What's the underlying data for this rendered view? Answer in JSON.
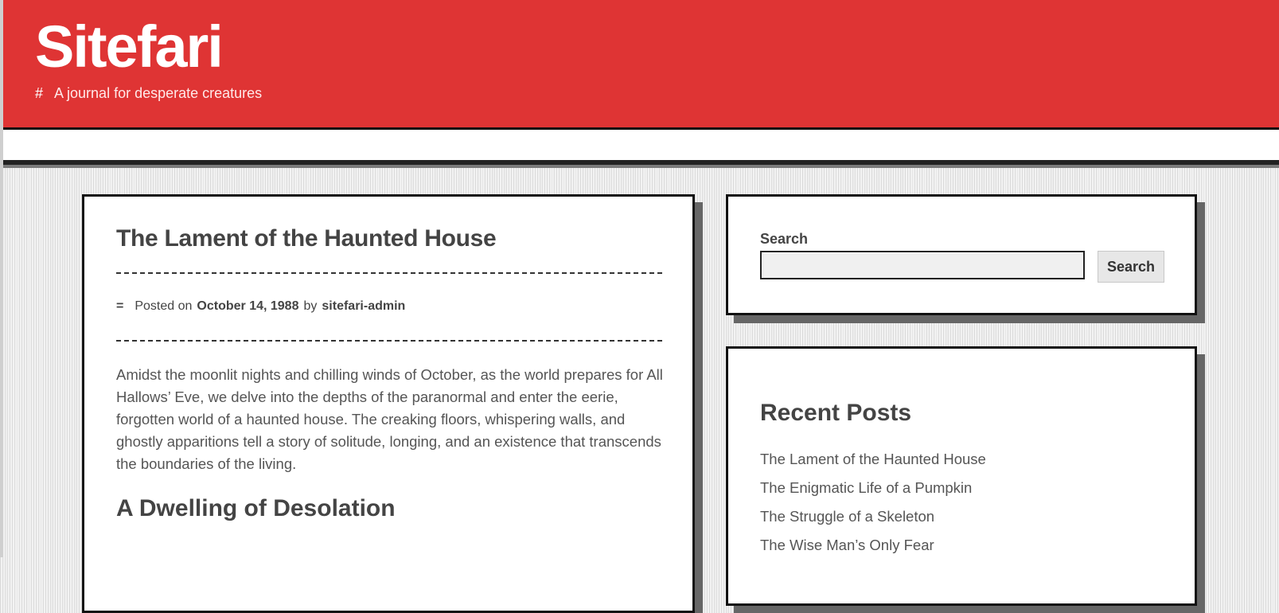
{
  "site": {
    "title": "Sitefari",
    "tagline_icon": "#",
    "tagline": "A journal for desperate creatures"
  },
  "post": {
    "title": "The Lament of the Haunted House",
    "meta_icon": "=",
    "posted_on_label": "Posted on",
    "date": "October 14, 1988",
    "by_label": "by",
    "author": "sitefari-admin",
    "body": "Amidst the moonlit nights and chilling winds of October, as the world prepares for All Hallows’ Eve, we delve into the depths of the paranormal and enter the eerie, forgotten world of a haunted house. The creaking floors, whispering walls, and ghostly apparitions tell a story of solitude, longing, and an existence that transcends the boundaries of the living.",
    "section_heading": "A Dwelling of Desolation"
  },
  "sidebar": {
    "search": {
      "label": "Search",
      "value": "",
      "button_label": "Search"
    },
    "recent_posts": {
      "title": "Recent Posts",
      "items": [
        "The Lament of the Haunted House",
        "The Enigmatic Life of a Pumpkin",
        "The Struggle of a Skeleton",
        "The Wise Man’s Only Fear"
      ]
    }
  },
  "colors": {
    "header_bg": "#df3434",
    "card_shadow": "#666666",
    "text": "#444444"
  }
}
